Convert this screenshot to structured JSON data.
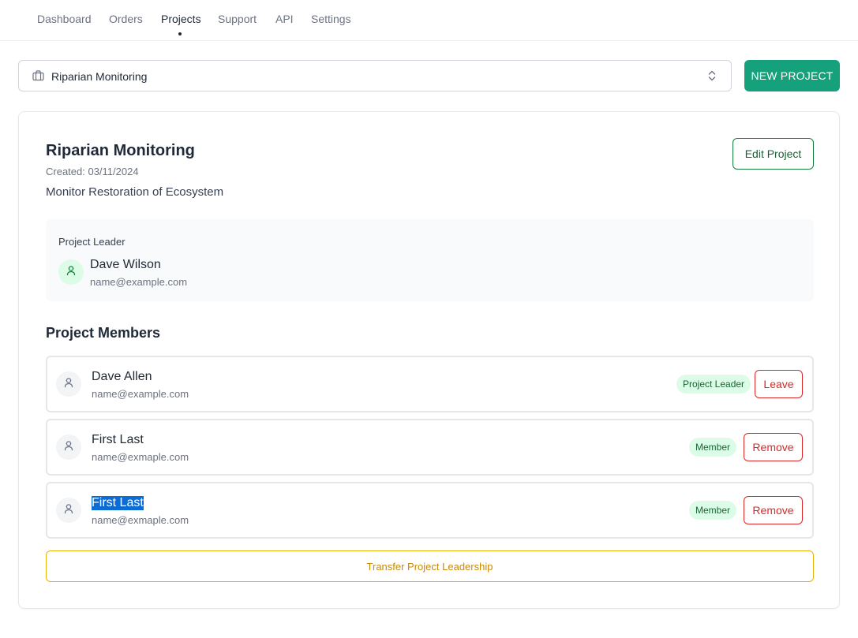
{
  "nav": {
    "items": [
      {
        "label": "Dashboard"
      },
      {
        "label": "Orders"
      },
      {
        "label": "Projects"
      },
      {
        "label": "Support"
      },
      {
        "label": "API"
      },
      {
        "label": "Settings"
      }
    ],
    "active": "Projects"
  },
  "project_select": {
    "value": "Riparian Monitoring",
    "icon": "briefcase-icon"
  },
  "new_project_label": "NEW PROJECT",
  "project": {
    "title": "Riparian Monitoring",
    "created": "Created: 03/11/2024",
    "description": "Monitor Restoration of Ecosystem",
    "edit_label": "Edit Project"
  },
  "leader": {
    "caption": "Project Leader",
    "name": "Dave Wilson",
    "email": "name@example.com"
  },
  "members_title": "Project Members",
  "members": [
    {
      "name": "Dave Allen",
      "email": "name@example.com",
      "role": "Project Leader",
      "action": "Leave"
    },
    {
      "name": "First Last",
      "email": "name@exmaple.com",
      "role": "Member",
      "action": "Remove"
    },
    {
      "name": "First Last",
      "email": "name@exmaple.com",
      "role": "Member",
      "action": "Remove"
    }
  ],
  "transfer_label": "Transfer Project Leadership",
  "colors": {
    "accent": "#14a17c",
    "danger": "#dc2626",
    "warning": "#ca8a04",
    "badge_bg": "#dcfce7",
    "selection": "#0b6cd6"
  }
}
